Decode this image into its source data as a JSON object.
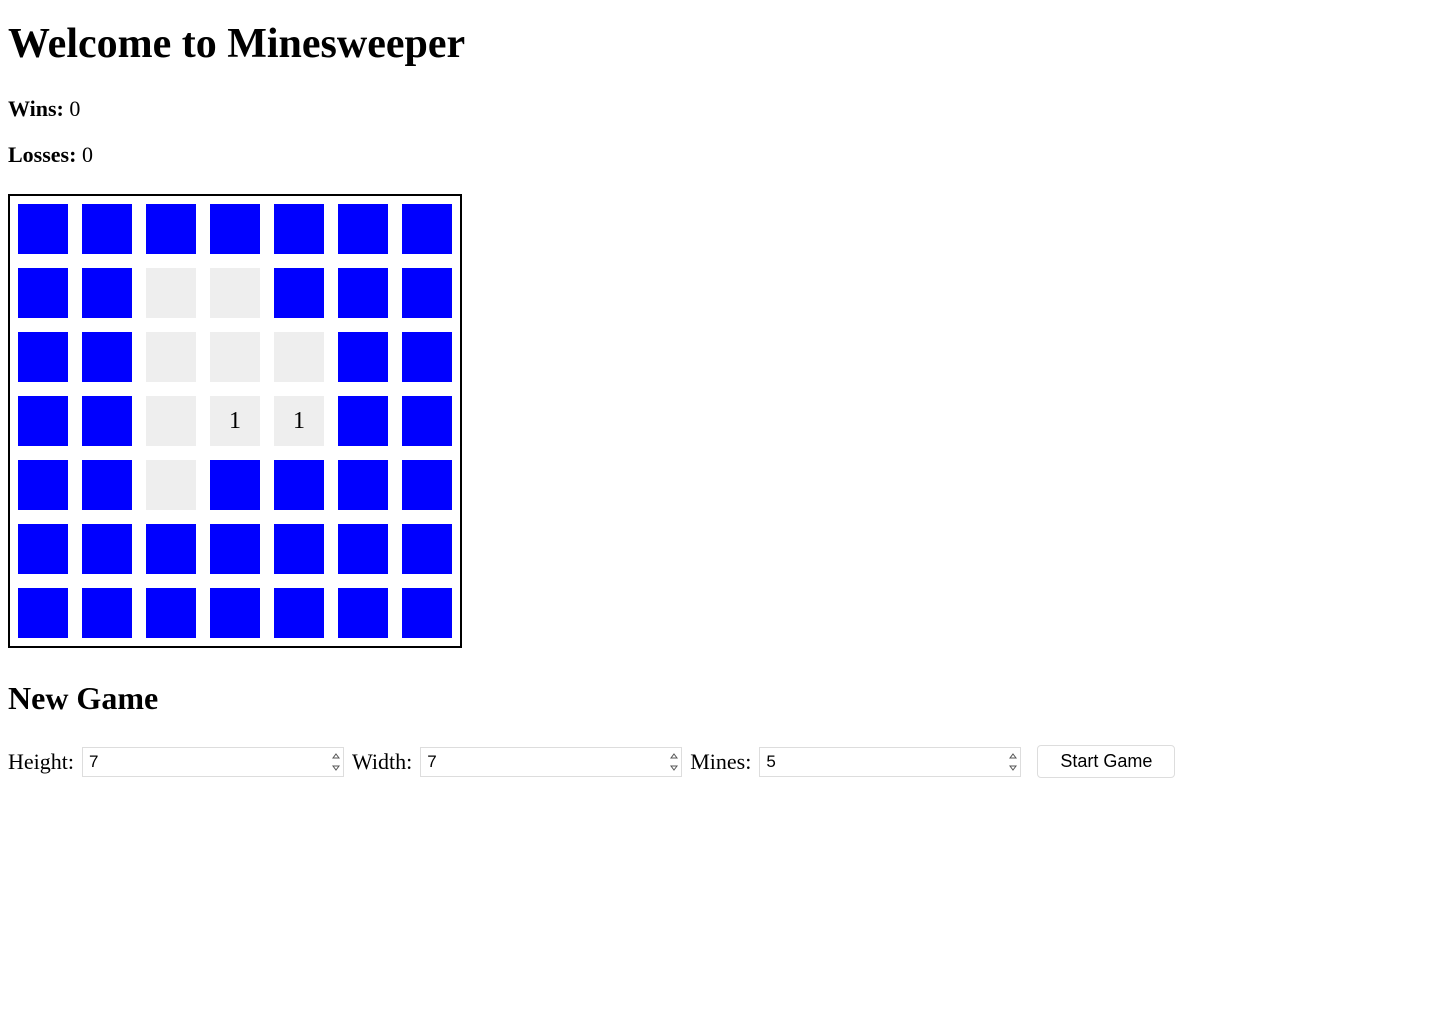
{
  "title": "Welcome to Minesweeper",
  "stats": {
    "wins_label": "Wins:",
    "wins_value": "0",
    "losses_label": "Losses:",
    "losses_value": "0"
  },
  "board": {
    "rows": 7,
    "cols": 7,
    "cells": [
      [
        {
          "s": "u",
          "t": ""
        },
        {
          "s": "u",
          "t": ""
        },
        {
          "s": "u",
          "t": ""
        },
        {
          "s": "u",
          "t": ""
        },
        {
          "s": "u",
          "t": ""
        },
        {
          "s": "u",
          "t": ""
        },
        {
          "s": "u",
          "t": ""
        }
      ],
      [
        {
          "s": "u",
          "t": ""
        },
        {
          "s": "u",
          "t": ""
        },
        {
          "s": "r",
          "t": ""
        },
        {
          "s": "r",
          "t": ""
        },
        {
          "s": "u",
          "t": ""
        },
        {
          "s": "u",
          "t": ""
        },
        {
          "s": "u",
          "t": ""
        }
      ],
      [
        {
          "s": "u",
          "t": ""
        },
        {
          "s": "u",
          "t": ""
        },
        {
          "s": "r",
          "t": ""
        },
        {
          "s": "r",
          "t": ""
        },
        {
          "s": "r",
          "t": ""
        },
        {
          "s": "u",
          "t": ""
        },
        {
          "s": "u",
          "t": ""
        }
      ],
      [
        {
          "s": "u",
          "t": ""
        },
        {
          "s": "u",
          "t": ""
        },
        {
          "s": "r",
          "t": ""
        },
        {
          "s": "r",
          "t": "1"
        },
        {
          "s": "r",
          "t": "1"
        },
        {
          "s": "u",
          "t": ""
        },
        {
          "s": "u",
          "t": ""
        }
      ],
      [
        {
          "s": "u",
          "t": ""
        },
        {
          "s": "u",
          "t": ""
        },
        {
          "s": "r",
          "t": ""
        },
        {
          "s": "u",
          "t": ""
        },
        {
          "s": "u",
          "t": ""
        },
        {
          "s": "u",
          "t": ""
        },
        {
          "s": "u",
          "t": ""
        }
      ],
      [
        {
          "s": "u",
          "t": ""
        },
        {
          "s": "u",
          "t": ""
        },
        {
          "s": "u",
          "t": ""
        },
        {
          "s": "u",
          "t": ""
        },
        {
          "s": "u",
          "t": ""
        },
        {
          "s": "u",
          "t": ""
        },
        {
          "s": "u",
          "t": ""
        }
      ],
      [
        {
          "s": "u",
          "t": ""
        },
        {
          "s": "u",
          "t": ""
        },
        {
          "s": "u",
          "t": ""
        },
        {
          "s": "u",
          "t": ""
        },
        {
          "s": "u",
          "t": ""
        },
        {
          "s": "u",
          "t": ""
        },
        {
          "s": "u",
          "t": ""
        }
      ]
    ]
  },
  "newgame": {
    "heading": "New Game",
    "height_label": "Height:",
    "height_value": "7",
    "width_label": "Width:",
    "width_value": "7",
    "mines_label": "Mines:",
    "mines_value": "5",
    "start_label": "Start Game"
  },
  "colors": {
    "unrevealed": "#0000ff",
    "revealed": "#eeeeee"
  }
}
